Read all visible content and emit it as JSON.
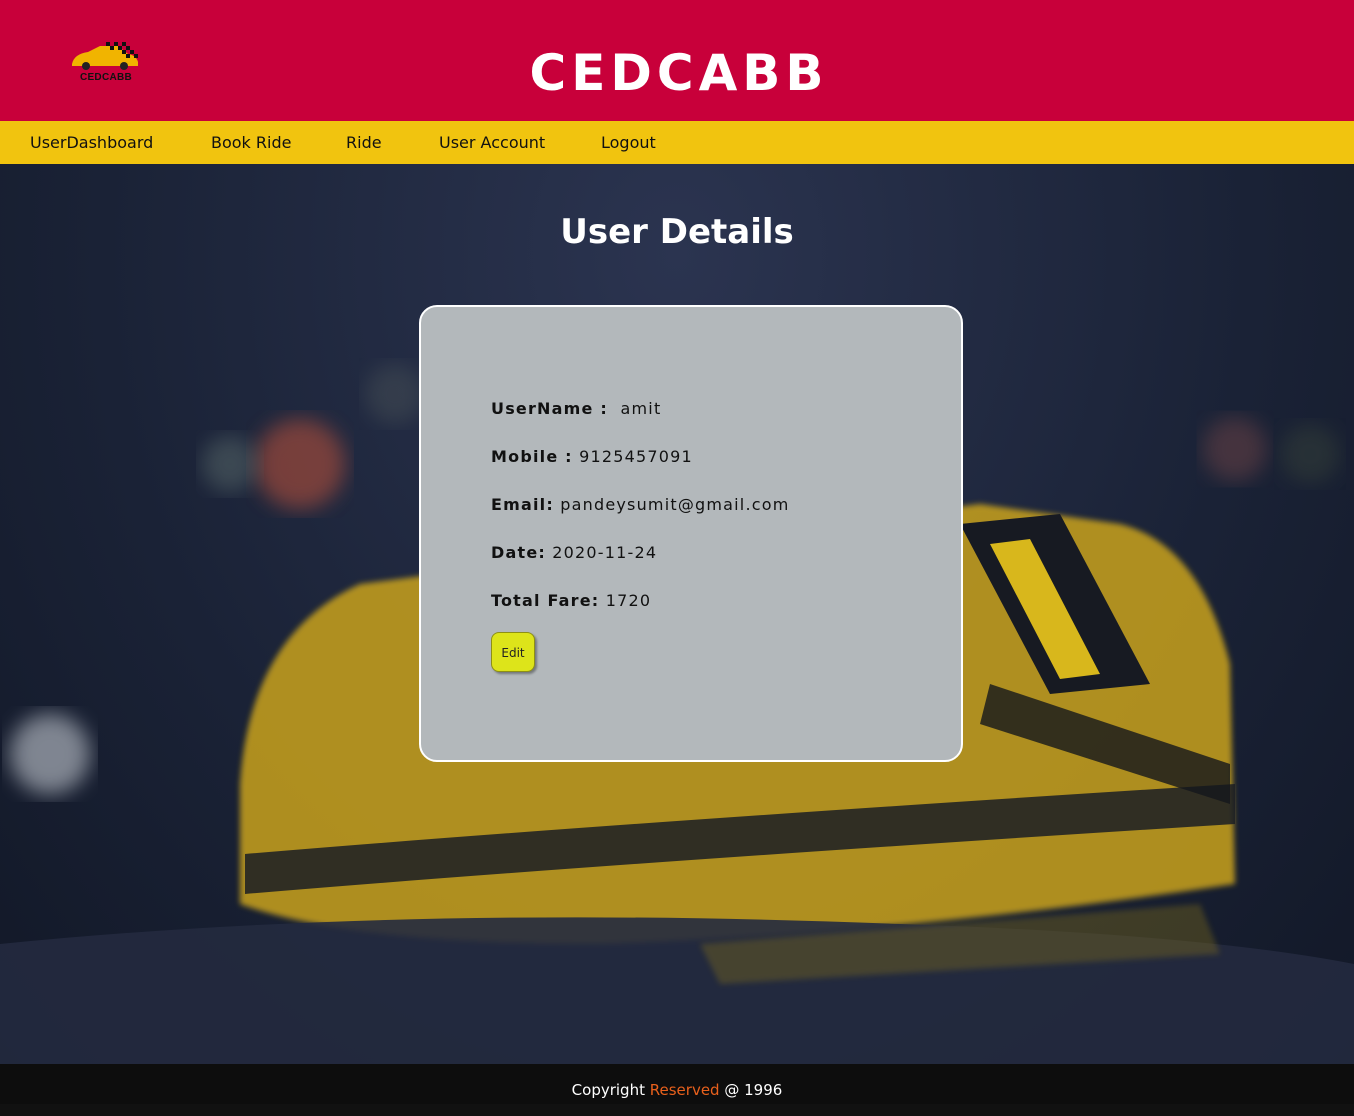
{
  "header": {
    "title": "CEDCABB",
    "logo_text": "CEDCABB"
  },
  "nav": {
    "items": [
      {
        "label": "UserDashboard"
      },
      {
        "label": "Book Ride"
      },
      {
        "label": "Ride"
      },
      {
        "label": "User Account"
      },
      {
        "label": "Logout"
      }
    ]
  },
  "main": {
    "heading": "User Details",
    "details": {
      "username_label": "UserName :",
      "username_value": "amit",
      "mobile_label": "Mobile :",
      "mobile_value": "9125457091",
      "email_label": "Email:",
      "email_value": "pandeysumit@gmail.com",
      "date_label": "Date:",
      "date_value": "2020-11-24",
      "fare_label": "Total Fare:",
      "fare_value": "1720"
    },
    "edit_label": "Edit"
  },
  "footer": {
    "prefix": "Copyright",
    "accent": "Reserved",
    "suffix": "@ 1996"
  },
  "colors": {
    "header_bg": "#c8003a",
    "nav_bg": "#f1c40f",
    "card_bg": "#b3b8bb",
    "edit_button_bg": "#dde41a",
    "footer_accent": "#e8601c"
  }
}
